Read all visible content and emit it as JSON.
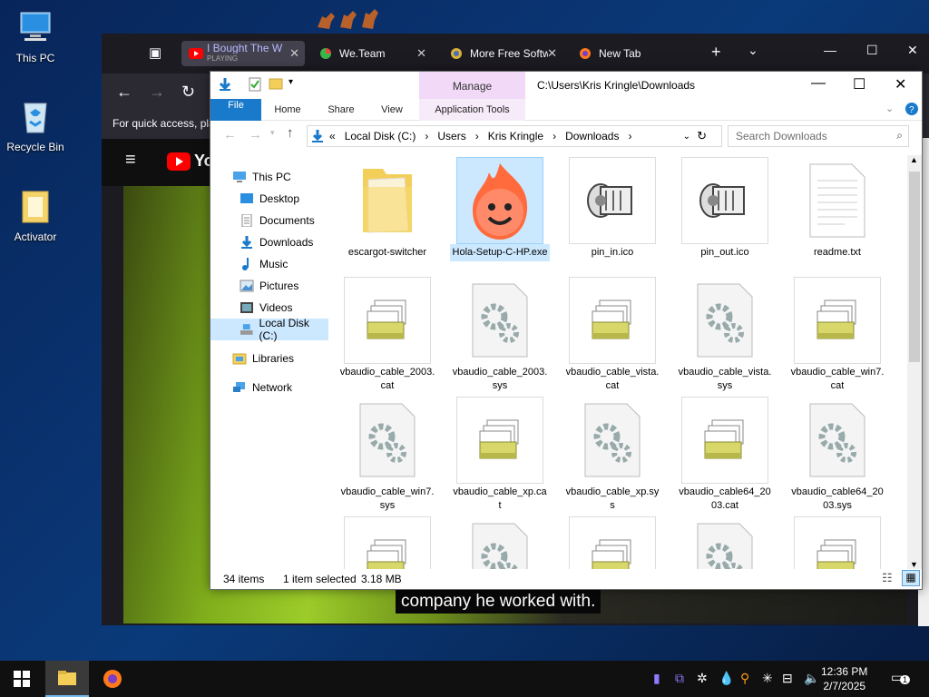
{
  "desktop": {
    "icons": [
      {
        "label": "This PC"
      },
      {
        "label": "Recycle Bin"
      },
      {
        "label": "Activator"
      }
    ]
  },
  "browser": {
    "tabs": [
      {
        "title": "I Bought The W",
        "sub": "PLAYING"
      },
      {
        "title": "We.Team"
      },
      {
        "title": "More Free Softw"
      },
      {
        "title": "New Tab"
      }
    ],
    "quick_access_text": "For quick access, pla",
    "youtube_logo": "Yo",
    "caption": "company he worked with."
  },
  "explorer": {
    "title_path": "C:\\Users\\Kris Kringle\\Downloads",
    "manage_label": "Manage",
    "ribbon_tabs": [
      "File",
      "Home",
      "Share",
      "View",
      "Application Tools"
    ],
    "breadcrumb": [
      "«",
      "Local Disk (C:)",
      "›",
      "Users",
      "›",
      "Kris Kringle",
      "›",
      "Downloads",
      "›"
    ],
    "search_placeholder": "Search Downloads",
    "nav": [
      {
        "label": "This PC"
      },
      {
        "label": "Desktop"
      },
      {
        "label": "Documents"
      },
      {
        "label": "Downloads"
      },
      {
        "label": "Music"
      },
      {
        "label": "Pictures"
      },
      {
        "label": "Videos"
      },
      {
        "label": "Local Disk (C:)"
      },
      {
        "label": "Libraries"
      },
      {
        "label": "Network"
      }
    ],
    "files": [
      {
        "name": "escargot-switcher",
        "type": "folder"
      },
      {
        "name": "Hola-Setup-C-HP.exe",
        "type": "hola"
      },
      {
        "name": "pin_in.ico",
        "type": "ico"
      },
      {
        "name": "pin_out.ico",
        "type": "ico"
      },
      {
        "name": "readme.txt",
        "type": "txt"
      },
      {
        "name": "vbaudio_cable_2003.cat",
        "type": "cat"
      },
      {
        "name": "vbaudio_cable_2003.sys",
        "type": "sys"
      },
      {
        "name": "vbaudio_cable_vista.cat",
        "type": "cat"
      },
      {
        "name": "vbaudio_cable_vista.sys",
        "type": "sys"
      },
      {
        "name": "vbaudio_cable_win7.cat",
        "type": "cat"
      },
      {
        "name": "vbaudio_cable_win7.sys",
        "type": "sys"
      },
      {
        "name": "vbaudio_cable_xp.cat",
        "type": "cat"
      },
      {
        "name": "vbaudio_cable_xp.sys",
        "type": "sys"
      },
      {
        "name": "vbaudio_cable64_2003.cat",
        "type": "cat"
      },
      {
        "name": "vbaudio_cable64_2003.sys",
        "type": "sys"
      }
    ],
    "status": {
      "count": "34 items",
      "selection": "1 item selected",
      "size": "3.18 MB"
    }
  },
  "taskbar": {
    "time": "12:36 PM",
    "date": "2/7/2025",
    "notification_count": "1"
  },
  "colors": {
    "accent": "#1979ca",
    "selection": "#cce8ff",
    "manage_tab": "#f1d9f7"
  }
}
